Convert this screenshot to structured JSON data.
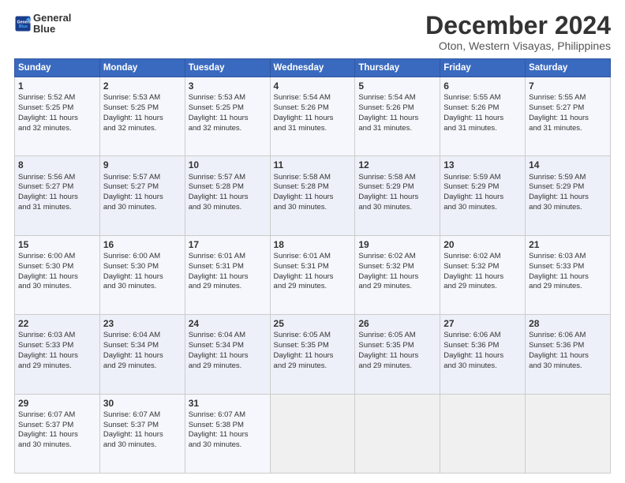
{
  "logo": {
    "line1": "General",
    "line2": "Blue"
  },
  "title": "December 2024",
  "subtitle": "Oton, Western Visayas, Philippines",
  "days_of_week": [
    "Sunday",
    "Monday",
    "Tuesday",
    "Wednesday",
    "Thursday",
    "Friday",
    "Saturday"
  ],
  "weeks": [
    [
      {
        "day": "1",
        "lines": [
          "Sunrise: 5:52 AM",
          "Sunset: 5:25 PM",
          "Daylight: 11 hours",
          "and 32 minutes."
        ]
      },
      {
        "day": "2",
        "lines": [
          "Sunrise: 5:53 AM",
          "Sunset: 5:25 PM",
          "Daylight: 11 hours",
          "and 32 minutes."
        ]
      },
      {
        "day": "3",
        "lines": [
          "Sunrise: 5:53 AM",
          "Sunset: 5:25 PM",
          "Daylight: 11 hours",
          "and 32 minutes."
        ]
      },
      {
        "day": "4",
        "lines": [
          "Sunrise: 5:54 AM",
          "Sunset: 5:26 PM",
          "Daylight: 11 hours",
          "and 31 minutes."
        ]
      },
      {
        "day": "5",
        "lines": [
          "Sunrise: 5:54 AM",
          "Sunset: 5:26 PM",
          "Daylight: 11 hours",
          "and 31 minutes."
        ]
      },
      {
        "day": "6",
        "lines": [
          "Sunrise: 5:55 AM",
          "Sunset: 5:26 PM",
          "Daylight: 11 hours",
          "and 31 minutes."
        ]
      },
      {
        "day": "7",
        "lines": [
          "Sunrise: 5:55 AM",
          "Sunset: 5:27 PM",
          "Daylight: 11 hours",
          "and 31 minutes."
        ]
      }
    ],
    [
      {
        "day": "8",
        "lines": [
          "Sunrise: 5:56 AM",
          "Sunset: 5:27 PM",
          "Daylight: 11 hours",
          "and 31 minutes."
        ]
      },
      {
        "day": "9",
        "lines": [
          "Sunrise: 5:57 AM",
          "Sunset: 5:27 PM",
          "Daylight: 11 hours",
          "and 30 minutes."
        ]
      },
      {
        "day": "10",
        "lines": [
          "Sunrise: 5:57 AM",
          "Sunset: 5:28 PM",
          "Daylight: 11 hours",
          "and 30 minutes."
        ]
      },
      {
        "day": "11",
        "lines": [
          "Sunrise: 5:58 AM",
          "Sunset: 5:28 PM",
          "Daylight: 11 hours",
          "and 30 minutes."
        ]
      },
      {
        "day": "12",
        "lines": [
          "Sunrise: 5:58 AM",
          "Sunset: 5:29 PM",
          "Daylight: 11 hours",
          "and 30 minutes."
        ]
      },
      {
        "day": "13",
        "lines": [
          "Sunrise: 5:59 AM",
          "Sunset: 5:29 PM",
          "Daylight: 11 hours",
          "and 30 minutes."
        ]
      },
      {
        "day": "14",
        "lines": [
          "Sunrise: 5:59 AM",
          "Sunset: 5:29 PM",
          "Daylight: 11 hours",
          "and 30 minutes."
        ]
      }
    ],
    [
      {
        "day": "15",
        "lines": [
          "Sunrise: 6:00 AM",
          "Sunset: 5:30 PM",
          "Daylight: 11 hours",
          "and 30 minutes."
        ]
      },
      {
        "day": "16",
        "lines": [
          "Sunrise: 6:00 AM",
          "Sunset: 5:30 PM",
          "Daylight: 11 hours",
          "and 30 minutes."
        ]
      },
      {
        "day": "17",
        "lines": [
          "Sunrise: 6:01 AM",
          "Sunset: 5:31 PM",
          "Daylight: 11 hours",
          "and 29 minutes."
        ]
      },
      {
        "day": "18",
        "lines": [
          "Sunrise: 6:01 AM",
          "Sunset: 5:31 PM",
          "Daylight: 11 hours",
          "and 29 minutes."
        ]
      },
      {
        "day": "19",
        "lines": [
          "Sunrise: 6:02 AM",
          "Sunset: 5:32 PM",
          "Daylight: 11 hours",
          "and 29 minutes."
        ]
      },
      {
        "day": "20",
        "lines": [
          "Sunrise: 6:02 AM",
          "Sunset: 5:32 PM",
          "Daylight: 11 hours",
          "and 29 minutes."
        ]
      },
      {
        "day": "21",
        "lines": [
          "Sunrise: 6:03 AM",
          "Sunset: 5:33 PM",
          "Daylight: 11 hours",
          "and 29 minutes."
        ]
      }
    ],
    [
      {
        "day": "22",
        "lines": [
          "Sunrise: 6:03 AM",
          "Sunset: 5:33 PM",
          "Daylight: 11 hours",
          "and 29 minutes."
        ]
      },
      {
        "day": "23",
        "lines": [
          "Sunrise: 6:04 AM",
          "Sunset: 5:34 PM",
          "Daylight: 11 hours",
          "and 29 minutes."
        ]
      },
      {
        "day": "24",
        "lines": [
          "Sunrise: 6:04 AM",
          "Sunset: 5:34 PM",
          "Daylight: 11 hours",
          "and 29 minutes."
        ]
      },
      {
        "day": "25",
        "lines": [
          "Sunrise: 6:05 AM",
          "Sunset: 5:35 PM",
          "Daylight: 11 hours",
          "and 29 minutes."
        ]
      },
      {
        "day": "26",
        "lines": [
          "Sunrise: 6:05 AM",
          "Sunset: 5:35 PM",
          "Daylight: 11 hours",
          "and 29 minutes."
        ]
      },
      {
        "day": "27",
        "lines": [
          "Sunrise: 6:06 AM",
          "Sunset: 5:36 PM",
          "Daylight: 11 hours",
          "and 30 minutes."
        ]
      },
      {
        "day": "28",
        "lines": [
          "Sunrise: 6:06 AM",
          "Sunset: 5:36 PM",
          "Daylight: 11 hours",
          "and 30 minutes."
        ]
      }
    ],
    [
      {
        "day": "29",
        "lines": [
          "Sunrise: 6:07 AM",
          "Sunset: 5:37 PM",
          "Daylight: 11 hours",
          "and 30 minutes."
        ]
      },
      {
        "day": "30",
        "lines": [
          "Sunrise: 6:07 AM",
          "Sunset: 5:37 PM",
          "Daylight: 11 hours",
          "and 30 minutes."
        ]
      },
      {
        "day": "31",
        "lines": [
          "Sunrise: 6:07 AM",
          "Sunset: 5:38 PM",
          "Daylight: 11 hours",
          "and 30 minutes."
        ]
      },
      null,
      null,
      null,
      null
    ]
  ]
}
